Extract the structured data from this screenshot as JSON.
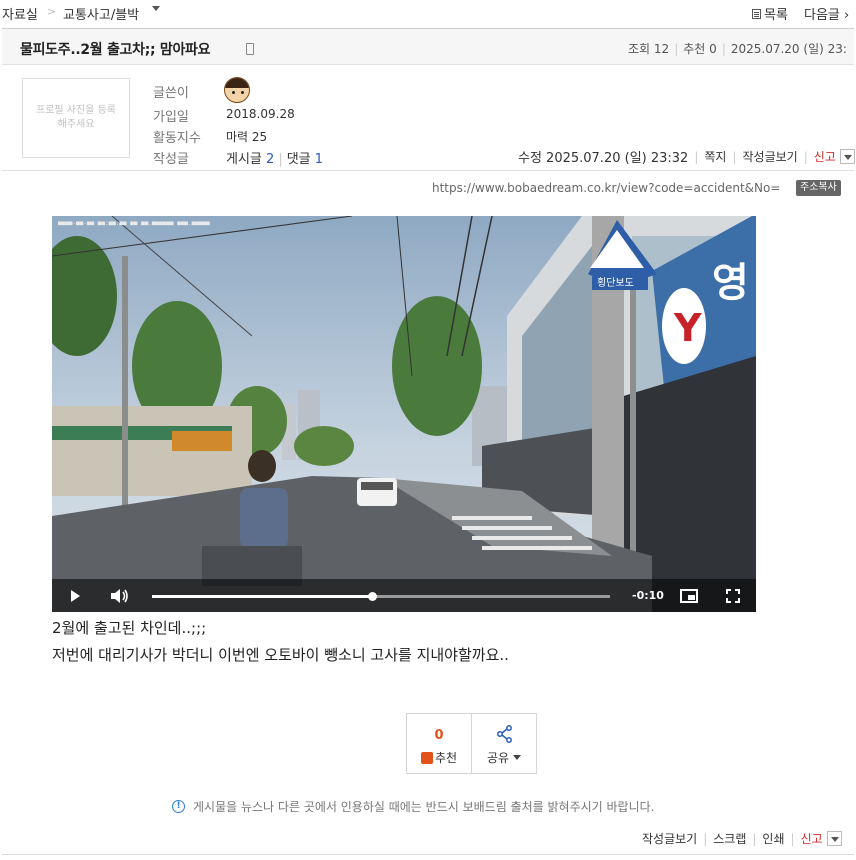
{
  "nav": {
    "home": "자료실",
    "sep": ">",
    "board": "교통사고/블박",
    "list": "목록",
    "next": "다음글"
  },
  "post": {
    "title": "물피도주..2월 출고차;; 맘아파요",
    "views_label": "조회",
    "views": "12",
    "recommend_label": "추천",
    "recommend": "0",
    "datetime": "2025.07.20 (일) 23:"
  },
  "author": {
    "profile_placeholder": "프로필 사진을 등록해주세요",
    "writer_label": "글쓴이",
    "joined_label": "가입일",
    "joined": "2018.09.28",
    "activity_label": "활동지수",
    "activity": "마력 25",
    "posts_label": "작성글",
    "post_count_label": "게시글",
    "post_count": "2",
    "comment_count_label": "댓글",
    "comment_count": "1"
  },
  "actions": {
    "edited": "수정 2025.07.20 (일) 23:32",
    "message": "쪽지",
    "view_posts": "작성글보기",
    "report": "신고"
  },
  "url": {
    "text": "https://www.bobaedream.co.kr/view?code=accident&No=",
    "copy": "주소복사"
  },
  "video": {
    "time": "-0:10",
    "progress": 0.48,
    "sign_text": "횡단보도",
    "banner_text": "영"
  },
  "body": {
    "line1": "2월에 출고된 차인데..;;;",
    "line2": "저번에 대리기사가 박더니 이번엔 오토바이 뺑소니 고사를 지내야할까요.."
  },
  "reactions": {
    "count": "0",
    "recommend": "추천",
    "share": "공유"
  },
  "notice": "게시물을 뉴스나 다른 곳에서 인용하실 때에는 반드시 보배드림 출처를 밝혀주시기 바랍니다.",
  "footer": {
    "view_posts": "작성글보기",
    "scrap": "스크랩",
    "print": "인쇄",
    "report": "신고"
  },
  "colors": {
    "accent_red": "#d52b2b",
    "link_blue": "#2a5bbf",
    "recommend_orange": "#e3521a"
  }
}
